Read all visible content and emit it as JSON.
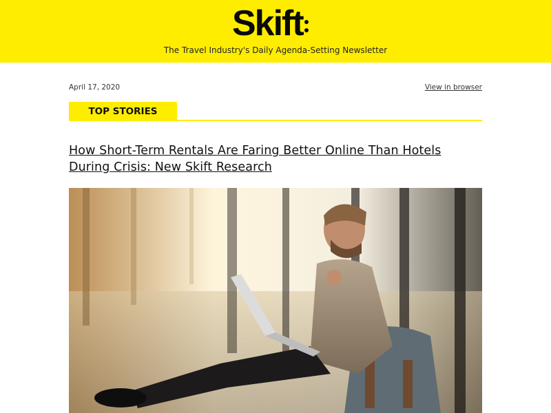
{
  "brand": {
    "name": "Skift",
    "tagline": "The Travel Industry's Daily Agenda-Setting Newsletter",
    "color": "#ffed00"
  },
  "meta": {
    "date": "April 17, 2020",
    "view_in_browser": "View in browser"
  },
  "section": {
    "label": "TOP STORIES"
  },
  "story": {
    "headline": "How Short-Term Rentals Are Faring Better Online Than Hotels During Crisis: New Skift Research"
  }
}
